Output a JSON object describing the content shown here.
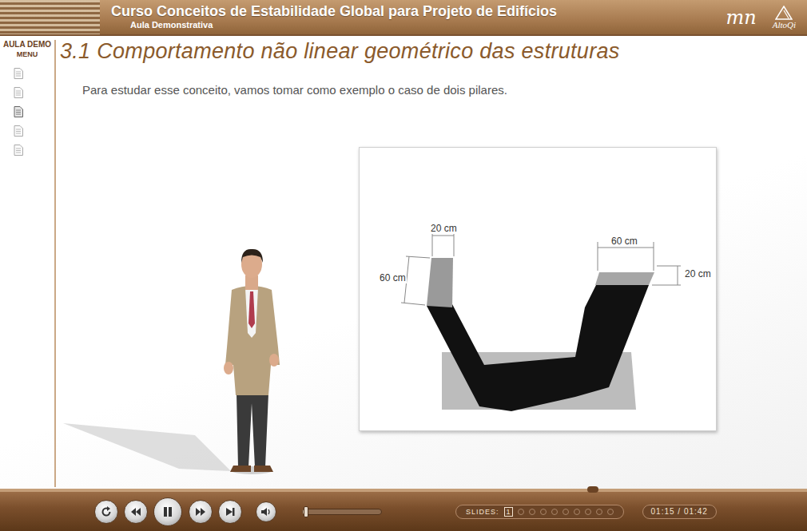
{
  "header": {
    "title": "Curso Conceitos de Estabilidade Global para Projeto de Edifícios",
    "subtitle": "Aula Demonstrativa",
    "logos": [
      "mn",
      "AltoQi"
    ]
  },
  "sidebar": {
    "title": "AULA DEMO",
    "menu_label": "MENU",
    "items": [
      {
        "selected": false
      },
      {
        "selected": false
      },
      {
        "selected": true
      },
      {
        "selected": false
      },
      {
        "selected": false
      }
    ]
  },
  "lesson": {
    "heading": "3.1 Comportamento não linear geométrico das estruturas",
    "text": "Para estudar esse conceito, vamos tomar como exemplo o caso de dois pilares."
  },
  "figure": {
    "labels": [
      "20 cm",
      "60 cm",
      "60 cm",
      "20 cm"
    ]
  },
  "player": {
    "playing": true,
    "progress": {
      "level": 0.735
    },
    "volume": {
      "level": 0.04
    },
    "slides_label": "SLIDES:",
    "slides": [
      {
        "label": "1",
        "selected": true
      },
      {
        "selected": false
      },
      {
        "selected": false
      },
      {
        "selected": false
      },
      {
        "selected": false
      },
      {
        "selected": false
      },
      {
        "selected": false
      },
      {
        "selected": false
      },
      {
        "selected": false
      },
      {
        "selected": false
      }
    ],
    "time": "01:15 / 01:42"
  }
}
